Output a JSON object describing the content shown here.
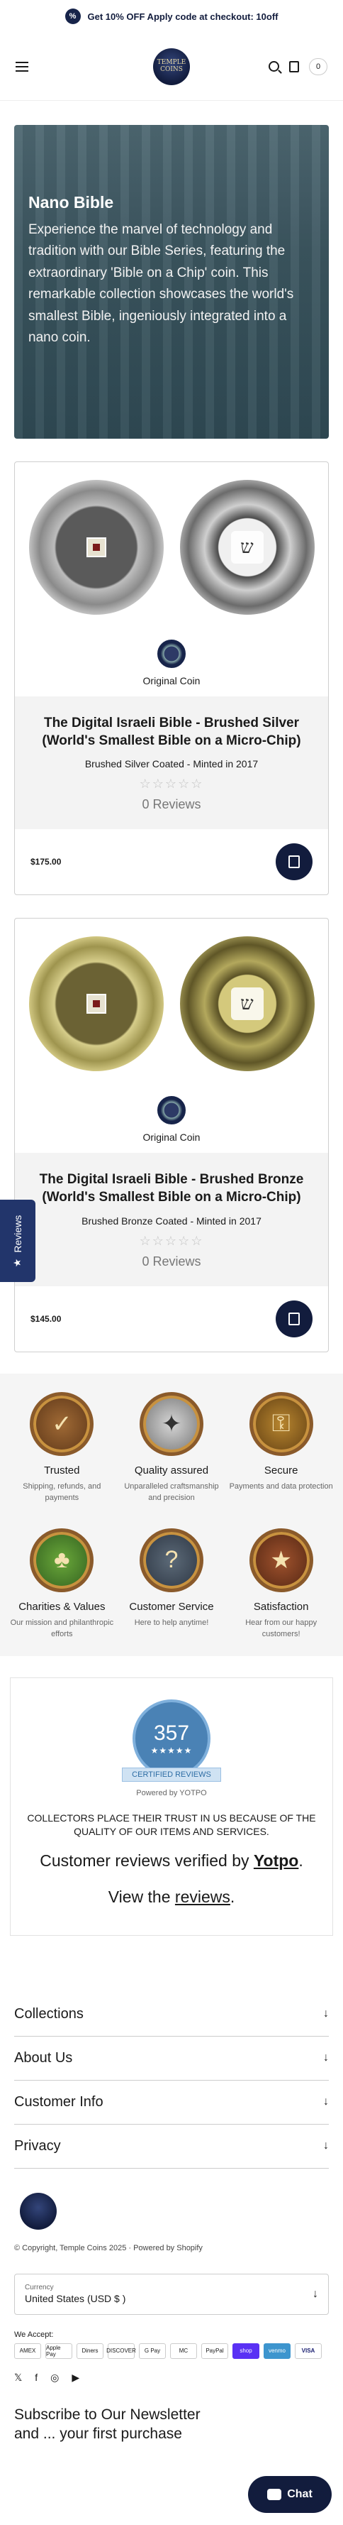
{
  "announcement": {
    "text": "Get 10% OFF Apply code at checkout: 10off"
  },
  "header": {
    "logo_text": "TEMPLE COINS",
    "cart_count": "0"
  },
  "hero": {
    "title": "Nano Bible",
    "text": "Experience the marvel of technology and tradition with our Bible Series, featuring the extraordinary 'Bible on a Chip' coin. This remarkable collection showcases the world's smallest Bible, ingeniously integrated into a nano coin."
  },
  "products": [
    {
      "variant_label": "Original Coin",
      "title": "The Digital Israeli Bible - Brushed Silver (World's Smallest Bible on a Micro-Chip)",
      "subtitle": "Brushed Silver Coated - Minted in 2017",
      "stars": "☆☆☆☆☆",
      "reviews": "0 Reviews",
      "price": "$175.00"
    },
    {
      "variant_label": "Original Coin",
      "title": "The Digital Israeli Bible - Brushed Bronze (World's Smallest Bible on a Micro-Chip)",
      "subtitle": "Brushed Bronze Coated - Minted in 2017",
      "stars": "☆☆☆☆☆",
      "reviews": "0 Reviews",
      "price": "$145.00"
    }
  ],
  "reviews_tab": {
    "label": "Reviews",
    "icon": "★"
  },
  "trust": [
    {
      "title": "Trusted",
      "desc": "Shipping, refunds, and payments",
      "icon": "shield-icon"
    },
    {
      "title": "Quality assured",
      "desc": "Unparalleled craftsmanship and precision",
      "icon": "medal-icon"
    },
    {
      "title": "Secure",
      "desc": "Payments and data protection",
      "icon": "lock-icon"
    },
    {
      "title": "Charities & Values",
      "desc": "Our mission and philanthropic efforts",
      "icon": "tree-icon"
    },
    {
      "title": "Customer Service",
      "desc": "Here to help anytime!",
      "icon": "question-icon"
    },
    {
      "title": "Satisfaction",
      "desc": "Hear from our happy customers!",
      "icon": "star-icon"
    }
  ],
  "yotpo": {
    "count": "357",
    "stars": "★★★★★",
    "ribbon": "CERTIFIED REVIEWS",
    "powered": "Powered by YOTPO",
    "quote": "COLLECTORS PLACE THEIR TRUST IN US BECAUSE OF THE QUALITY OF OUR ITEMS AND SERVICES.",
    "verified_prefix": "Customer reviews verified by ",
    "verified_brand": "Yotpo",
    "verified_suffix": ".",
    "view_prefix": "View the ",
    "view_link": "reviews",
    "view_suffix": "."
  },
  "footer": {
    "accordions": [
      "Collections",
      "About Us",
      "Customer Info",
      "Privacy"
    ],
    "arrow": "↓",
    "copyright": "© Copyright, Temple Coins 2025 · Powered by Shopify",
    "currency_label": "Currency",
    "currency_value": "United States (USD $ )",
    "accept_label": "We Accept:",
    "payments": [
      "AMEX",
      "Apple Pay",
      "Diners",
      "DISCOVER",
      "G Pay",
      "MC",
      "PayPal",
      "shop",
      "venmo",
      "VISA"
    ],
    "socials": [
      "𝕏",
      "f",
      "◎",
      "▶"
    ],
    "newsletter": "Subscribe to Our Newsletter and ... your first purchase"
  },
  "chat": {
    "label": "Chat"
  }
}
